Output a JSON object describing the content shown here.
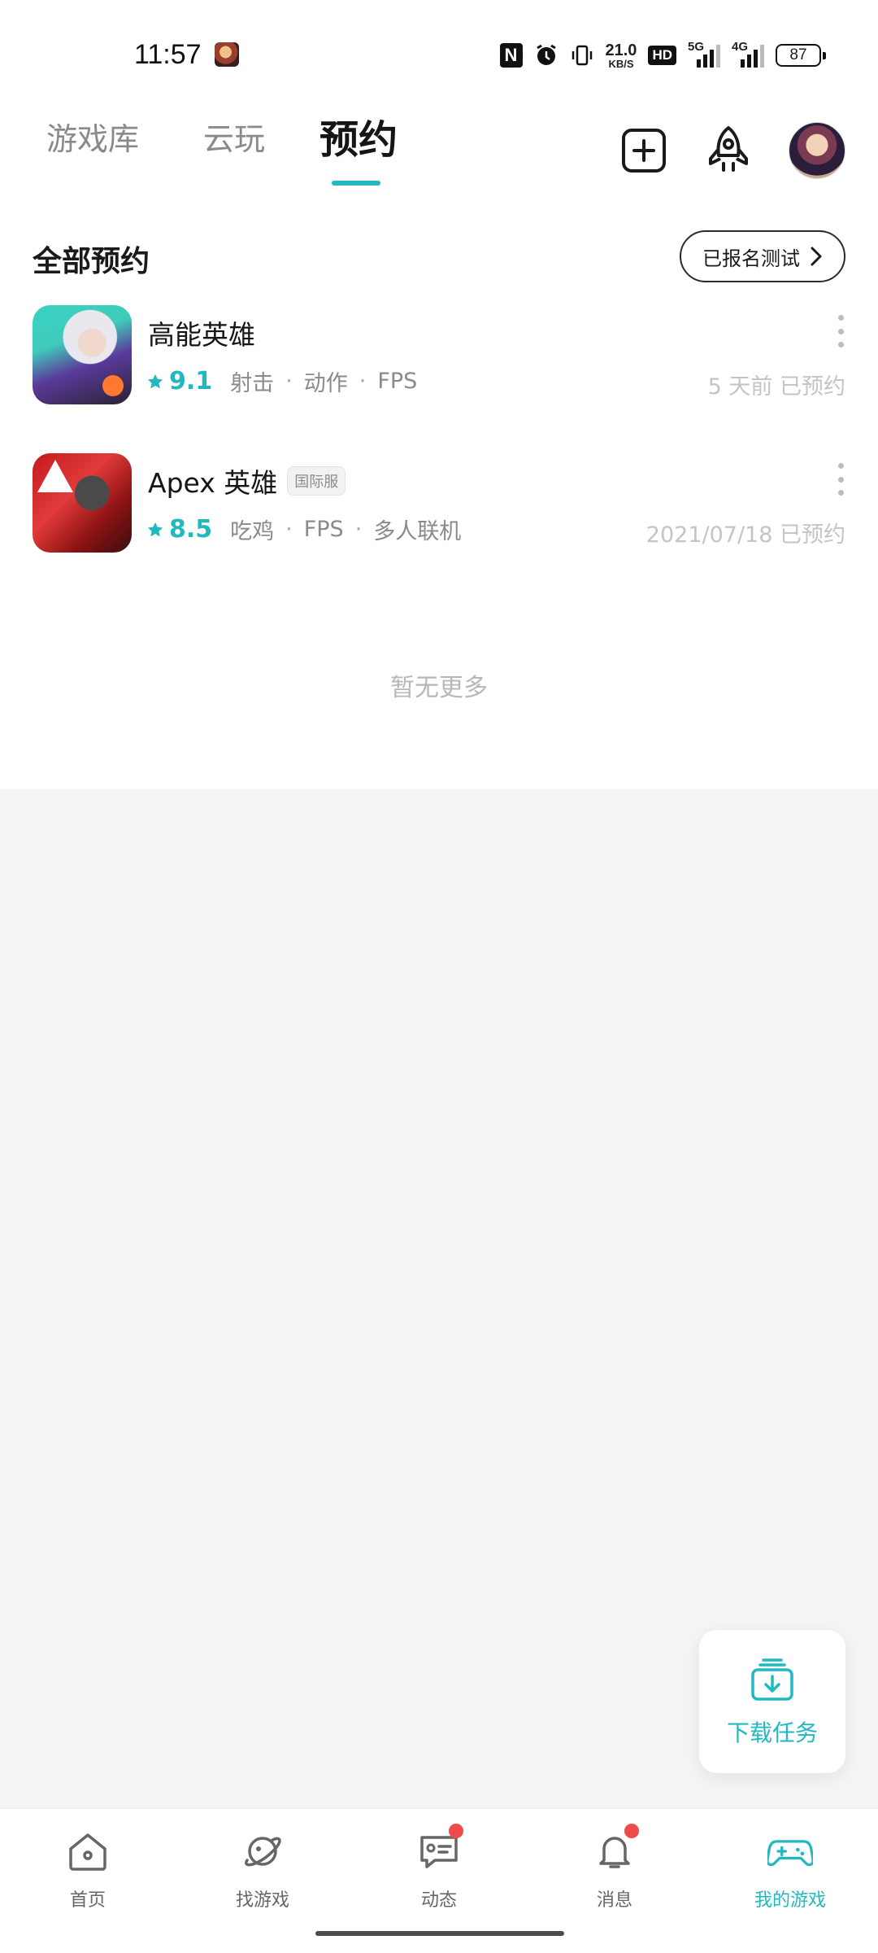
{
  "status_bar": {
    "time": "11:57",
    "speed_value": "21.0",
    "speed_unit": "KB/S",
    "hd_label": "HD",
    "signal_1_label": "5G",
    "signal_2_label": "4G",
    "battery": "87"
  },
  "header": {
    "tabs": [
      {
        "label": "游戏库",
        "active": false
      },
      {
        "label": "云玩",
        "active": false
      },
      {
        "label": "预约",
        "active": true
      }
    ]
  },
  "section": {
    "title": "全部预约",
    "registered_test_label": "已报名测试"
  },
  "games": [
    {
      "name": "高能英雄",
      "server_tag": "",
      "rating": "9.1",
      "tags": [
        "射击",
        "动作",
        "FPS"
      ],
      "status": "5 天前 已预约"
    },
    {
      "name": "Apex 英雄",
      "server_tag": "国际服",
      "rating": "8.5",
      "tags": [
        "吃鸡",
        "FPS",
        "多人联机"
      ],
      "status": "2021/07/18 已预约"
    }
  ],
  "list_end_text": "暂无更多",
  "download_task_label": "下载任务",
  "bottom_nav": [
    {
      "label": "首页",
      "icon": "home-icon",
      "badge": false,
      "active": false
    },
    {
      "label": "找游戏",
      "icon": "planet-icon",
      "badge": false,
      "active": false
    },
    {
      "label": "动态",
      "icon": "feed-icon",
      "badge": true,
      "active": false
    },
    {
      "label": "消息",
      "icon": "bell-icon",
      "badge": true,
      "active": false
    },
    {
      "label": "我的游戏",
      "icon": "gamepad-icon",
      "badge": false,
      "active": true
    }
  ],
  "colors": {
    "accent": "#22b8c0",
    "badge": "#ef4b4b",
    "muted_text": "#8a8a8a"
  }
}
